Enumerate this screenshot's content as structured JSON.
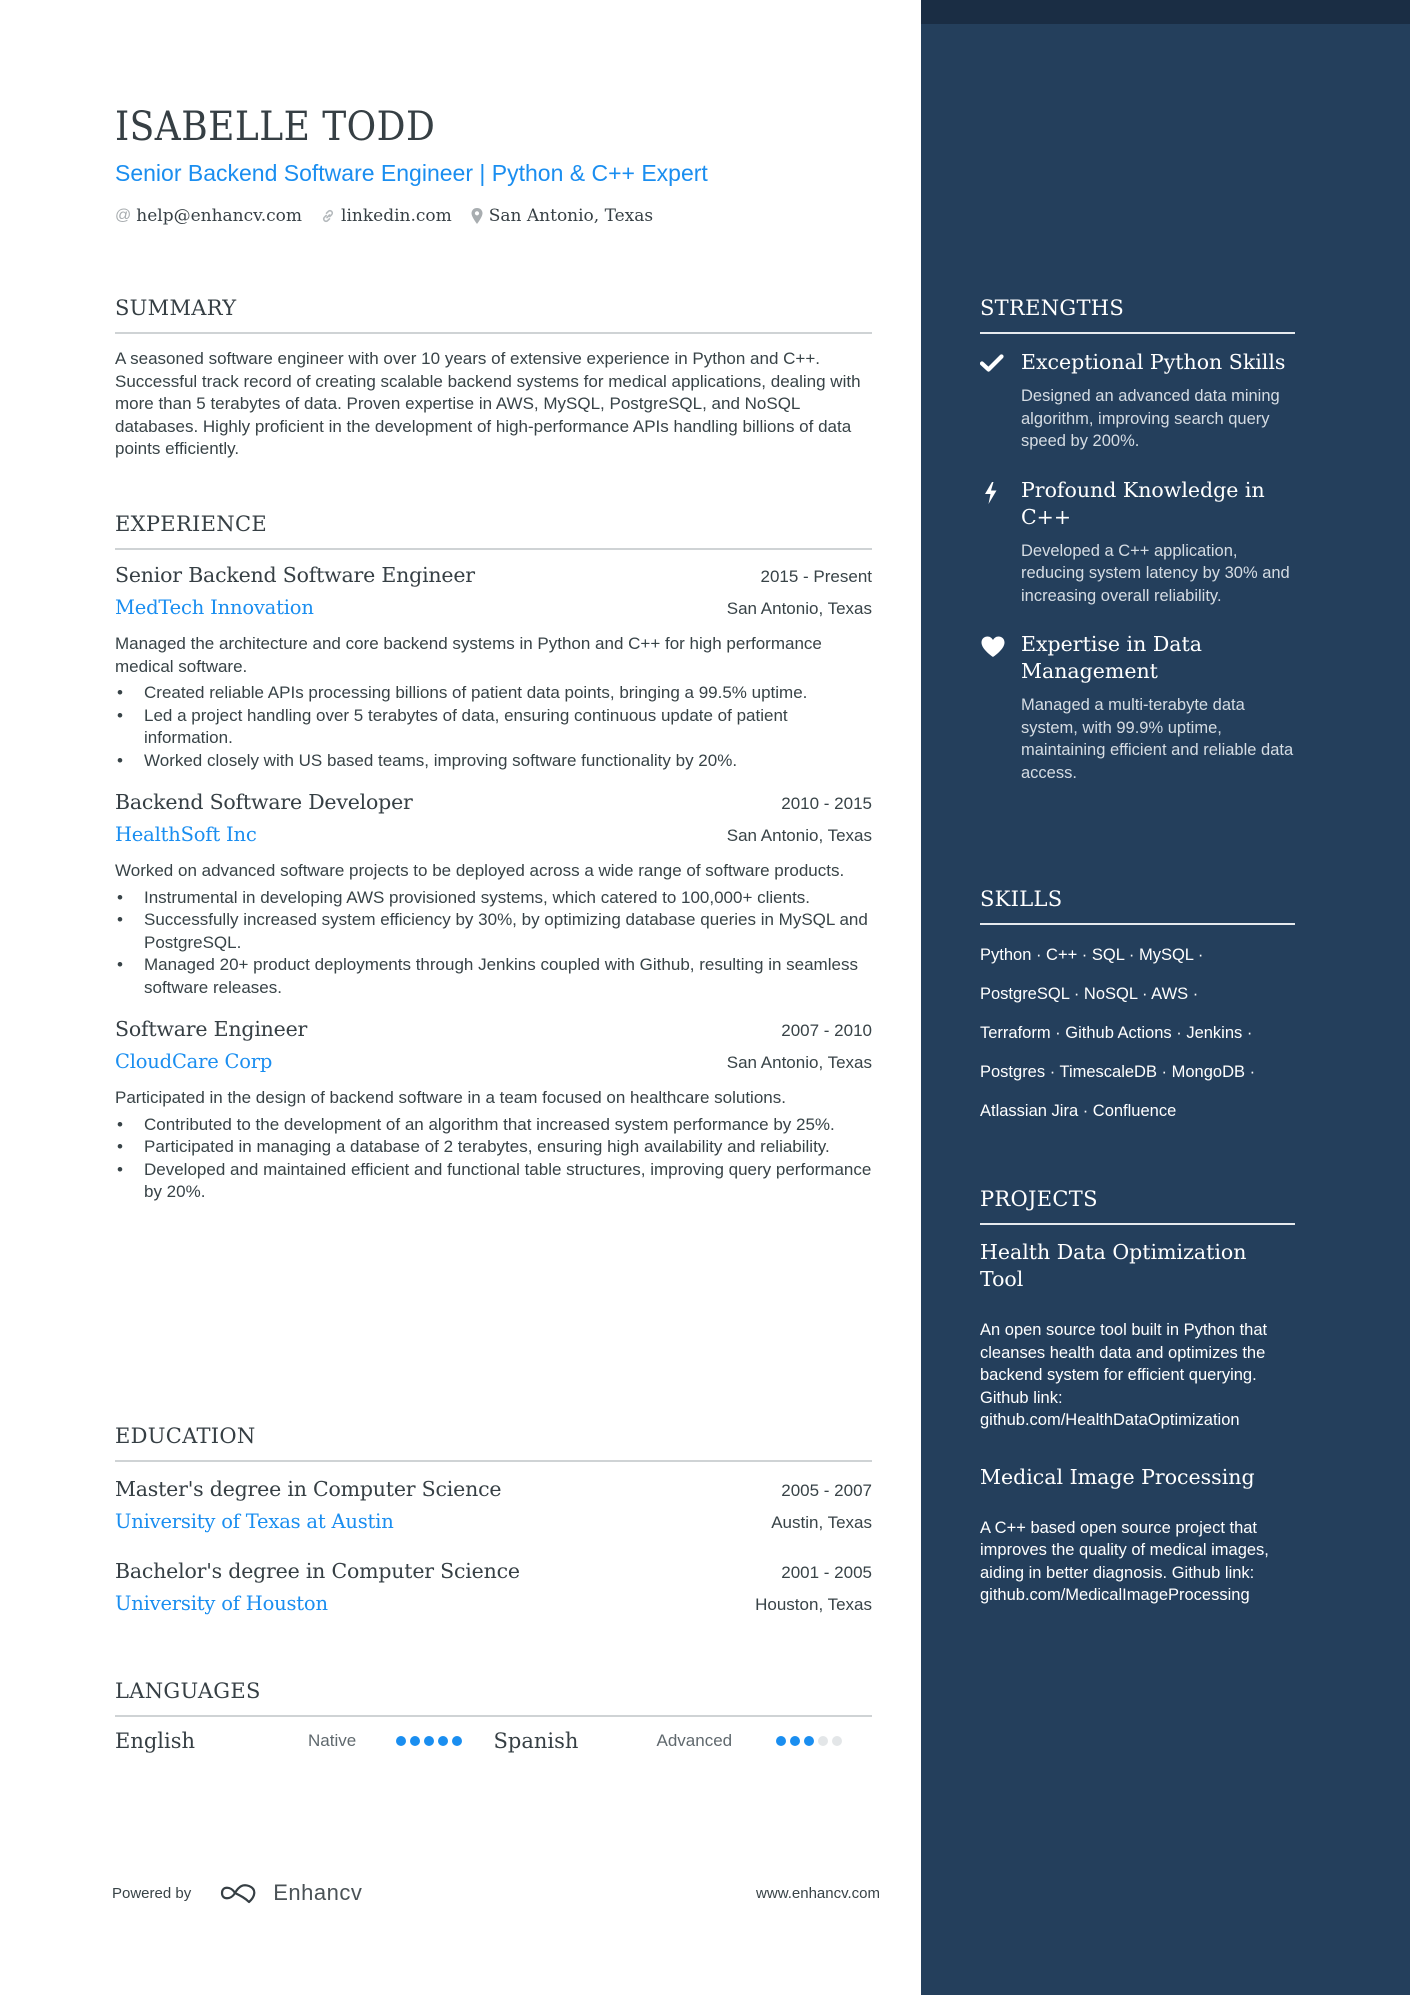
{
  "header": {
    "name": "ISABELLE TODD",
    "headline": "Senior Backend Software Engineer | Python & C++ Expert",
    "contacts": [
      {
        "icon": "at-icon",
        "text": "help@enhancv.com"
      },
      {
        "icon": "link-icon",
        "text": "linkedin.com"
      },
      {
        "icon": "location-pin-icon",
        "text": "San Antonio, Texas"
      }
    ]
  },
  "summary": {
    "title": "SUMMARY",
    "text": "A seasoned software engineer with over 10 years of extensive experience in Python and C++. Successful track record of creating scalable backend systems for medical applications, dealing with more than 5 terabytes of data. Proven expertise in AWS, MySQL, PostgreSQL, and NoSQL databases. Highly proficient in the development of high-performance APIs handling billions of data points efficiently."
  },
  "experience": {
    "title": "EXPERIENCE",
    "items": [
      {
        "role": "Senior Backend Software Engineer",
        "dates": "2015 - Present",
        "company": "MedTech Innovation",
        "location": "San Antonio, Texas",
        "description": "Managed the architecture and core backend systems in Python and C++ for high performance medical software.",
        "bullets": [
          "Created reliable APIs processing billions of patient data points, bringing a 99.5% uptime.",
          "Led a project handling over 5 terabytes of data, ensuring continuous update of patient information.",
          "Worked closely with US based teams, improving software functionality by 20%."
        ]
      },
      {
        "role": "Backend Software Developer",
        "dates": "2010 - 2015",
        "company": "HealthSoft Inc",
        "location": "San Antonio, Texas",
        "description": "Worked on advanced software projects to be deployed across a wide range of software products.",
        "bullets": [
          "Instrumental in developing AWS provisioned systems, which catered to 100,000+ clients.",
          "Successfully increased system efficiency by 30%, by optimizing database queries in MySQL and PostgreSQL.",
          "Managed 20+ product deployments through Jenkins coupled with Github, resulting in seamless software releases."
        ]
      },
      {
        "role": "Software Engineer",
        "dates": "2007 - 2010",
        "company": "CloudCare Corp",
        "location": "San Antonio, Texas",
        "description": "Participated in the design of backend software in a team focused on healthcare solutions.",
        "bullets": [
          "Contributed to the development of an algorithm that increased system performance by 25%.",
          "Participated in managing a database of 2 terabytes, ensuring high availability and reliability.",
          "Developed and maintained efficient and functional table structures, improving query performance by 20%."
        ]
      }
    ]
  },
  "education": {
    "title": "EDUCATION",
    "items": [
      {
        "degree": "Master's degree in Computer Science",
        "dates": "2005 - 2007",
        "school": "University of Texas at Austin",
        "location": "Austin, Texas"
      },
      {
        "degree": "Bachelor's degree in Computer Science",
        "dates": "2001 - 2005",
        "school": "University of Houston",
        "location": "Houston, Texas"
      }
    ]
  },
  "languages": {
    "title": "LANGUAGES",
    "items": [
      {
        "name": "English",
        "level": "Native",
        "rating": 5,
        "max": 5
      },
      {
        "name": "Spanish",
        "level": "Advanced",
        "rating": 3,
        "max": 5
      }
    ]
  },
  "strengths": {
    "title": "STRENGTHS",
    "items": [
      {
        "icon": "checkmark-icon",
        "title": "Exceptional Python Skills",
        "description": "Designed an advanced data mining algorithm, improving search query speed by 200%."
      },
      {
        "icon": "lightning-bolt-icon",
        "title": "Profound Knowledge in C++",
        "description": "Developed a C++ application, reducing system latency by 30% and increasing overall reliability."
      },
      {
        "icon": "heart-icon",
        "title": "Expertise in Data Management",
        "description": "Managed a multi-terabyte data system, with 99.9% uptime, maintaining efficient and reliable data access."
      }
    ]
  },
  "skills": {
    "title": "SKILLS",
    "items": [
      "Python",
      "C++",
      "SQL",
      "MySQL",
      "PostgreSQL",
      "NoSQL",
      "AWS",
      "Terraform",
      "Github Actions",
      "Jenkins",
      "Postgres",
      "TimescaleDB",
      "MongoDB",
      "Atlassian Jira",
      "Confluence"
    ],
    "lines": [
      "Python · C++ · SQL · MySQL ·",
      "PostgreSQL · NoSQL · AWS ·",
      "Terraform · Github Actions · Jenkins ·",
      "Postgres · TimescaleDB · MongoDB ·",
      "Atlassian Jira · Confluence"
    ]
  },
  "projects": {
    "title": "PROJECTS",
    "items": [
      {
        "title": "Health Data Optimization Tool",
        "description": "An open source tool built in Python that cleanses health data and optimizes the backend system for efficient querying. Github link: github.com/HealthDataOptimization"
      },
      {
        "title": "Medical Image Processing",
        "description": "A C++ based open source project that improves the quality of medical images, aiding in better diagnosis. Github link: github.com/MedicalImageProcessing"
      }
    ]
  },
  "footer": {
    "powered_by": "Powered by",
    "brand": "Enhancv",
    "website": "www.enhancv.com"
  },
  "colors": {
    "accent": "#1a8ef0",
    "sidebar": "#243f5c",
    "sidebar_top": "#1a2d44",
    "text": "#384347",
    "dot_off": "#e3e6e8"
  }
}
